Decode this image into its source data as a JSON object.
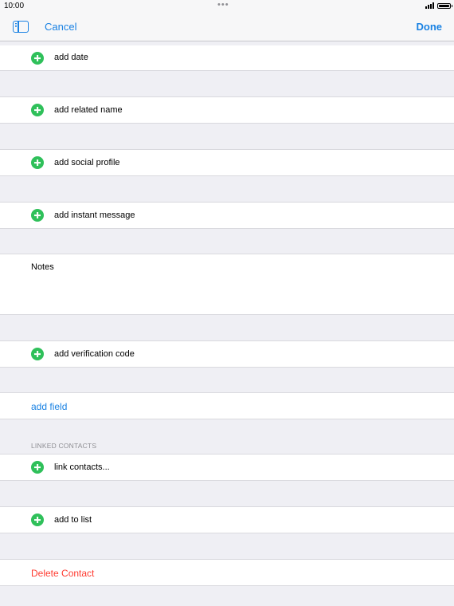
{
  "status_bar": {
    "time": "10:00",
    "dots": "•••"
  },
  "nav": {
    "cancel_label": "Cancel",
    "done_label": "Done"
  },
  "rows": {
    "add_date": "add date",
    "add_related_name": "add related name",
    "add_social_profile": "add social profile",
    "add_instant_message": "add instant message",
    "notes_label": "Notes",
    "add_verification_code": "add verification code",
    "add_field": "add field",
    "linked_contacts_header": "LINKED CONTACTS",
    "link_contacts": "link contacts...",
    "add_to_list": "add to list",
    "delete_contact": "Delete Contact"
  },
  "colors": {
    "accent": "#1a82e3",
    "add_green": "#2fc05a",
    "danger": "#ff3b30",
    "background": "#efeff4"
  },
  "icons": {
    "sidebar_toggle": "sidebar-icon",
    "add": "plus-circle-icon"
  }
}
